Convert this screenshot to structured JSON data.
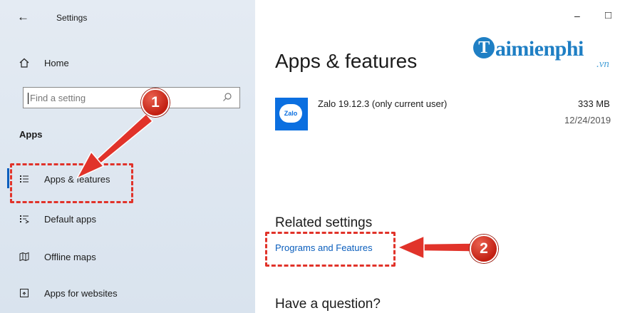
{
  "window": {
    "title": "Settings",
    "back_icon": "←",
    "minimize_icon": "–",
    "maximize_icon": "□"
  },
  "sidebar": {
    "home_label": "Home",
    "search_placeholder": "Find a setting",
    "section_title": "Apps",
    "items": [
      {
        "label": "Apps & features",
        "icon": "apps-features-icon"
      },
      {
        "label": "Default apps",
        "icon": "default-apps-icon"
      },
      {
        "label": "Offline maps",
        "icon": "offline-maps-icon"
      },
      {
        "label": "Apps for websites",
        "icon": "apps-for-websites-icon"
      }
    ]
  },
  "main": {
    "page_title": "Apps & features",
    "app_entry": {
      "icon_text": "Zalo",
      "name": "Zalo 19.12.3 (only current user)",
      "size": "333 MB",
      "date": "12/24/2019"
    },
    "related_settings_title": "Related settings",
    "programs_link": "Programs and Features",
    "question_title": "Have a question?"
  },
  "annotations": {
    "badge_1": "1",
    "badge_2": "2",
    "color": "#e1332a"
  },
  "watermark": {
    "initial": "T",
    "text": "aimienphi",
    "suffix": ".vn"
  }
}
